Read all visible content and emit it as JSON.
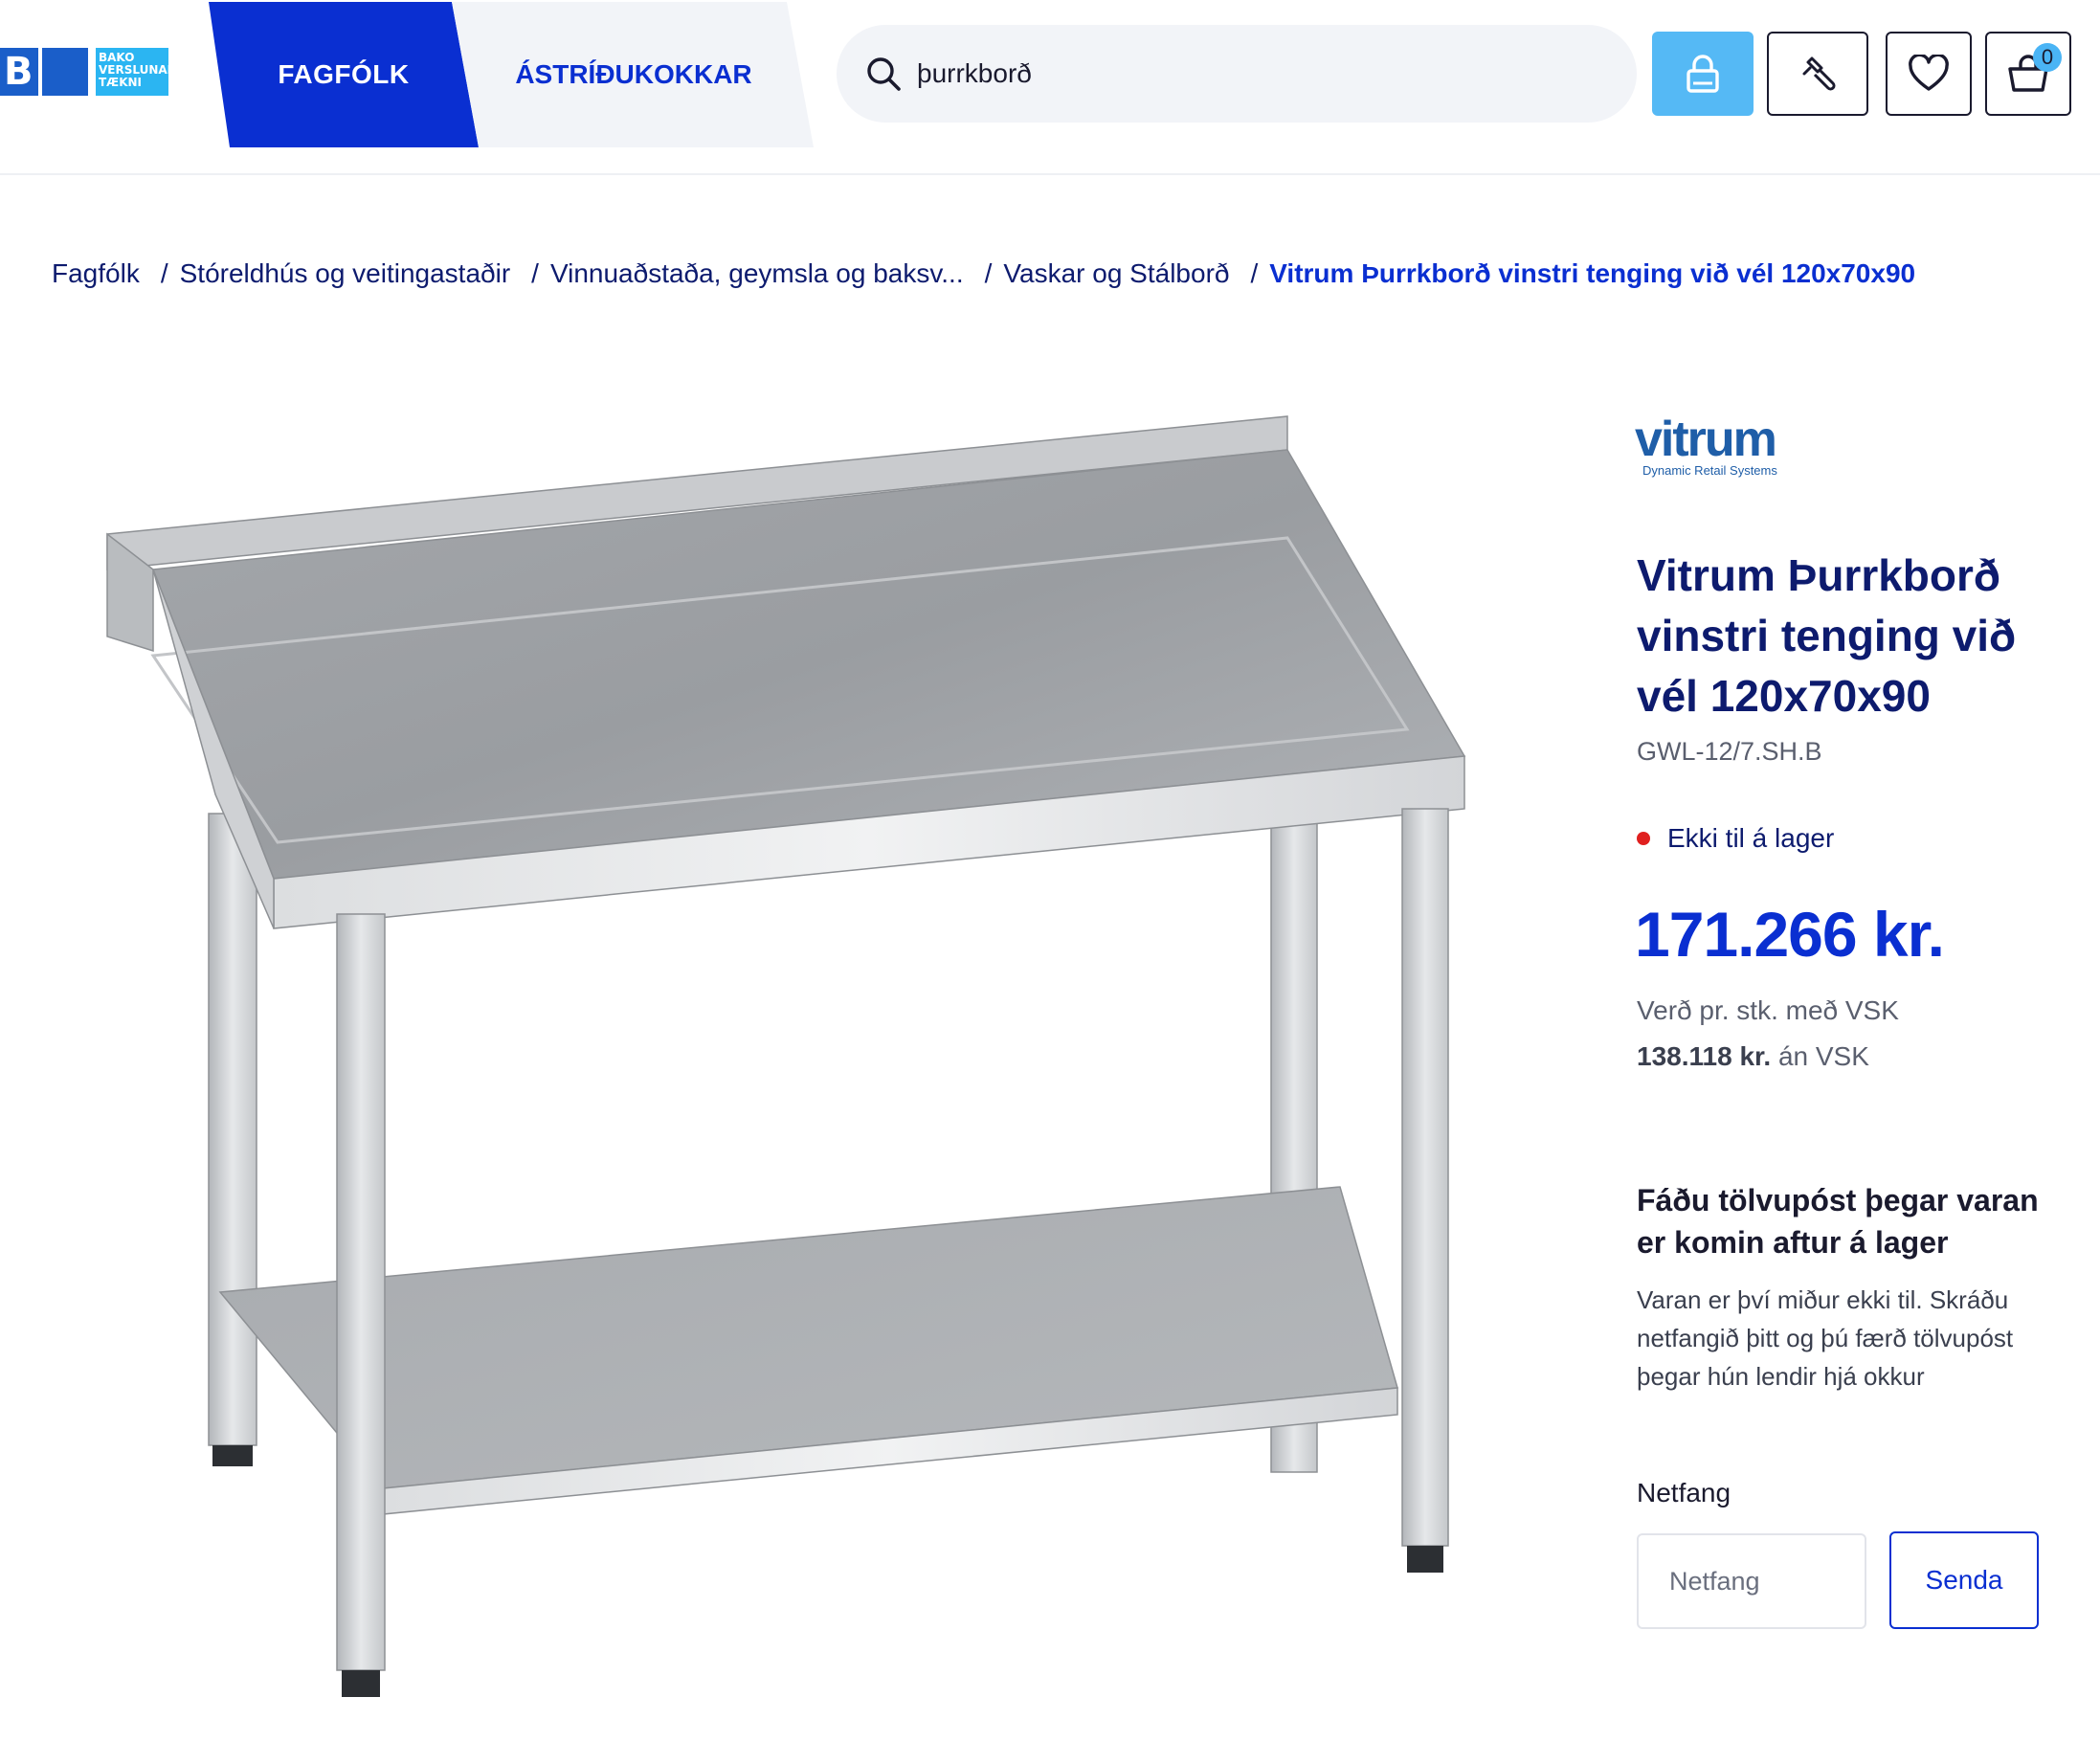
{
  "header": {
    "logo": {
      "mark": "BVT",
      "text_lines": [
        "BAKO",
        "VERSLUNAR",
        "TÆKNI"
      ]
    },
    "tabs": [
      {
        "label": "FAGFÓLK",
        "active": true
      },
      {
        "label": "ÁSTRÍÐUKOKKAR",
        "active": false
      }
    ],
    "search": {
      "value": "þurrkborð",
      "icon": "search-icon"
    },
    "icons": [
      "lock-icon",
      "wrench-icon",
      "heart-icon",
      "cart-icon"
    ],
    "cart_count": "0"
  },
  "breadcrumb": [
    "Fagfólk",
    "Stóreldhús og veitingastaðir",
    "Vinnuaðstaða, geymsla og baksv...",
    "Vaskar og Stálborð",
    "Vitrum Þurrkborð vinstri tenging við vél 120x70x90"
  ],
  "product": {
    "brand": {
      "name": "vitrum",
      "tagline": "Dynamic Retail Systems"
    },
    "title": "Vitrum Þurrkborð vinstri tenging við vél 120x70x90",
    "sku": "GWL-12/7.SH.B",
    "stock_status": "Ekki til á lager",
    "price": "171.266 kr.",
    "price_note": "Verð pr. stk. með VSK",
    "price_no_vat_amount": "138.118 kr.",
    "price_no_vat_label": "án VSK"
  },
  "notify": {
    "title": "Fáðu tölvupóst þegar varan er komin aftur á lager",
    "text": "Varan er því miður ekki til. Skráðu netfangið þitt og þú færð tölvupóst þegar hún lendir hjá okkur",
    "email_label": "Netfang",
    "email_placeholder": "Netfang",
    "send_label": "Senda"
  },
  "colors": {
    "primary": "#0a2fd1",
    "navy": "#0d1b6e",
    "lock_button": "#55b9f5",
    "out_of_stock": "#e0201f"
  }
}
